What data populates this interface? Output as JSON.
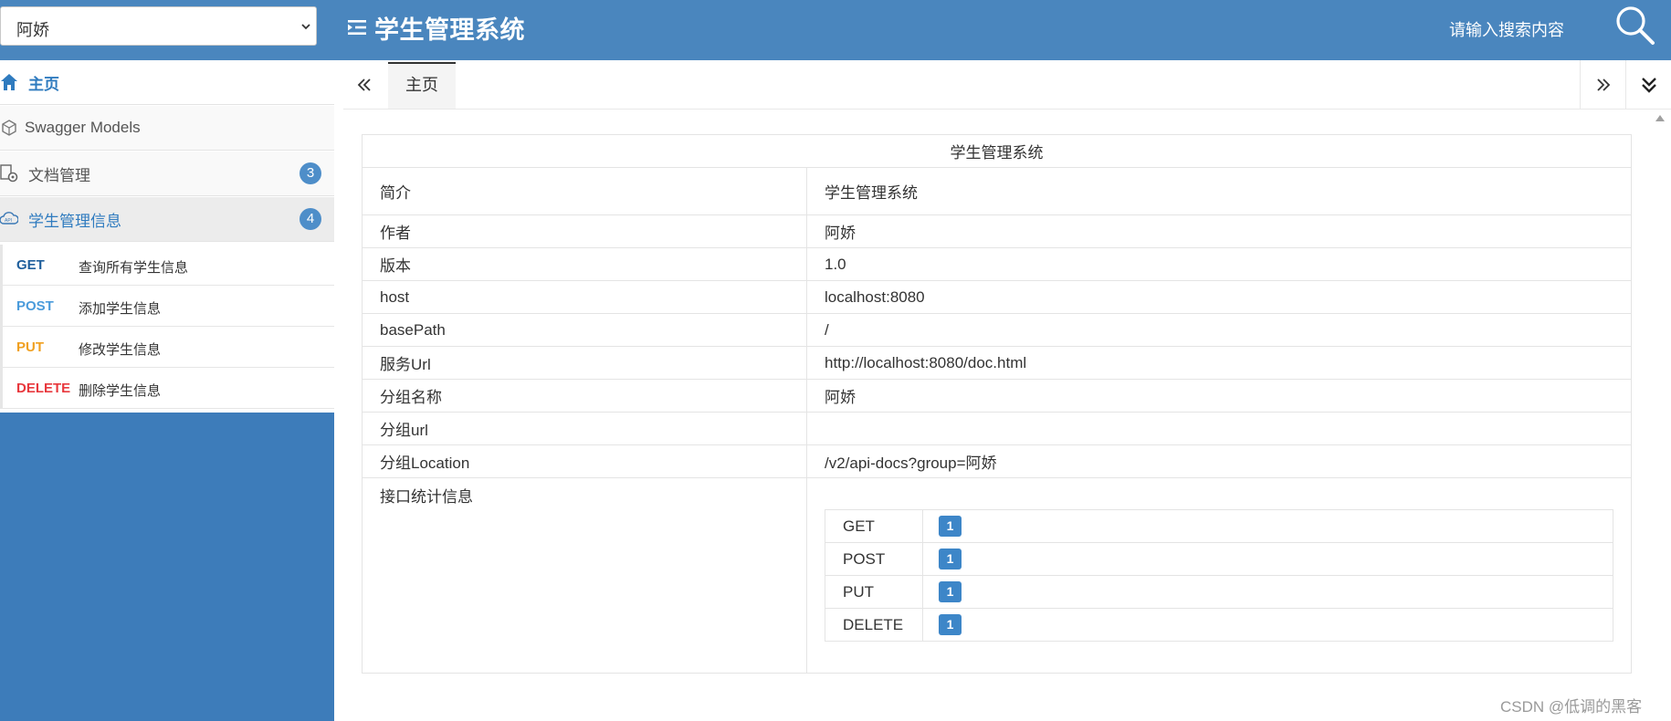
{
  "topbar": {
    "group_value": "阿娇",
    "title": "学生管理系统",
    "search_placeholder": "请输入搜索内容",
    "icons": [
      "chevron-down-icon",
      "menu-icon",
      "search-icon"
    ]
  },
  "sidebar": {
    "items": [
      {
        "label": "主页",
        "icon": "home-icon"
      },
      {
        "label": "Swagger Models",
        "icon": "models-icon"
      },
      {
        "label": "文档管理",
        "icon": "doc-settings-icon",
        "badge": "3"
      },
      {
        "label": "学生管理信息",
        "icon": "api-cloud-icon",
        "badge": "4"
      }
    ],
    "apis": [
      {
        "method": "GET",
        "desc": "查询所有学生信息",
        "color": "#1f5f9c"
      },
      {
        "method": "POST",
        "desc": "添加学生信息",
        "color": "#4a9bdb"
      },
      {
        "method": "PUT",
        "desc": "修改学生信息",
        "color": "#f0a020"
      },
      {
        "method": "DELETE",
        "desc": "删除学生信息",
        "color": "#e8383d"
      }
    ]
  },
  "tabs": {
    "home_label": "主页",
    "icons": [
      "double-chevron-left-icon",
      "double-chevron-right-icon",
      "double-chevron-down-icon"
    ]
  },
  "info": {
    "caption": "学生管理系统",
    "rows": [
      {
        "key": "简介",
        "value": "学生管理系统"
      },
      {
        "key": "作者",
        "value": "阿娇"
      },
      {
        "key": "版本",
        "value": "1.0"
      },
      {
        "key": "host",
        "value": "localhost:8080"
      },
      {
        "key": "basePath",
        "value": "/"
      },
      {
        "key": "服务Url",
        "value": "http://localhost:8080/doc.html"
      },
      {
        "key": "分组名称",
        "value": "阿娇"
      },
      {
        "key": "分组url",
        "value": ""
      },
      {
        "key": "分组Location",
        "value": "/v2/api-docs?group=阿娇"
      }
    ],
    "stats_key": "接口统计信息",
    "stats": [
      {
        "method": "GET",
        "count": "1"
      },
      {
        "method": "POST",
        "count": "1"
      },
      {
        "method": "PUT",
        "count": "1"
      },
      {
        "method": "DELETE",
        "count": "1"
      }
    ]
  },
  "colors": {
    "header_bg": "#4a86be",
    "sidebar_bg": "#3d7cba",
    "accent": "#2f7bbf",
    "badge": "#3d86c8"
  },
  "watermark": "CSDN @低调的黑客"
}
